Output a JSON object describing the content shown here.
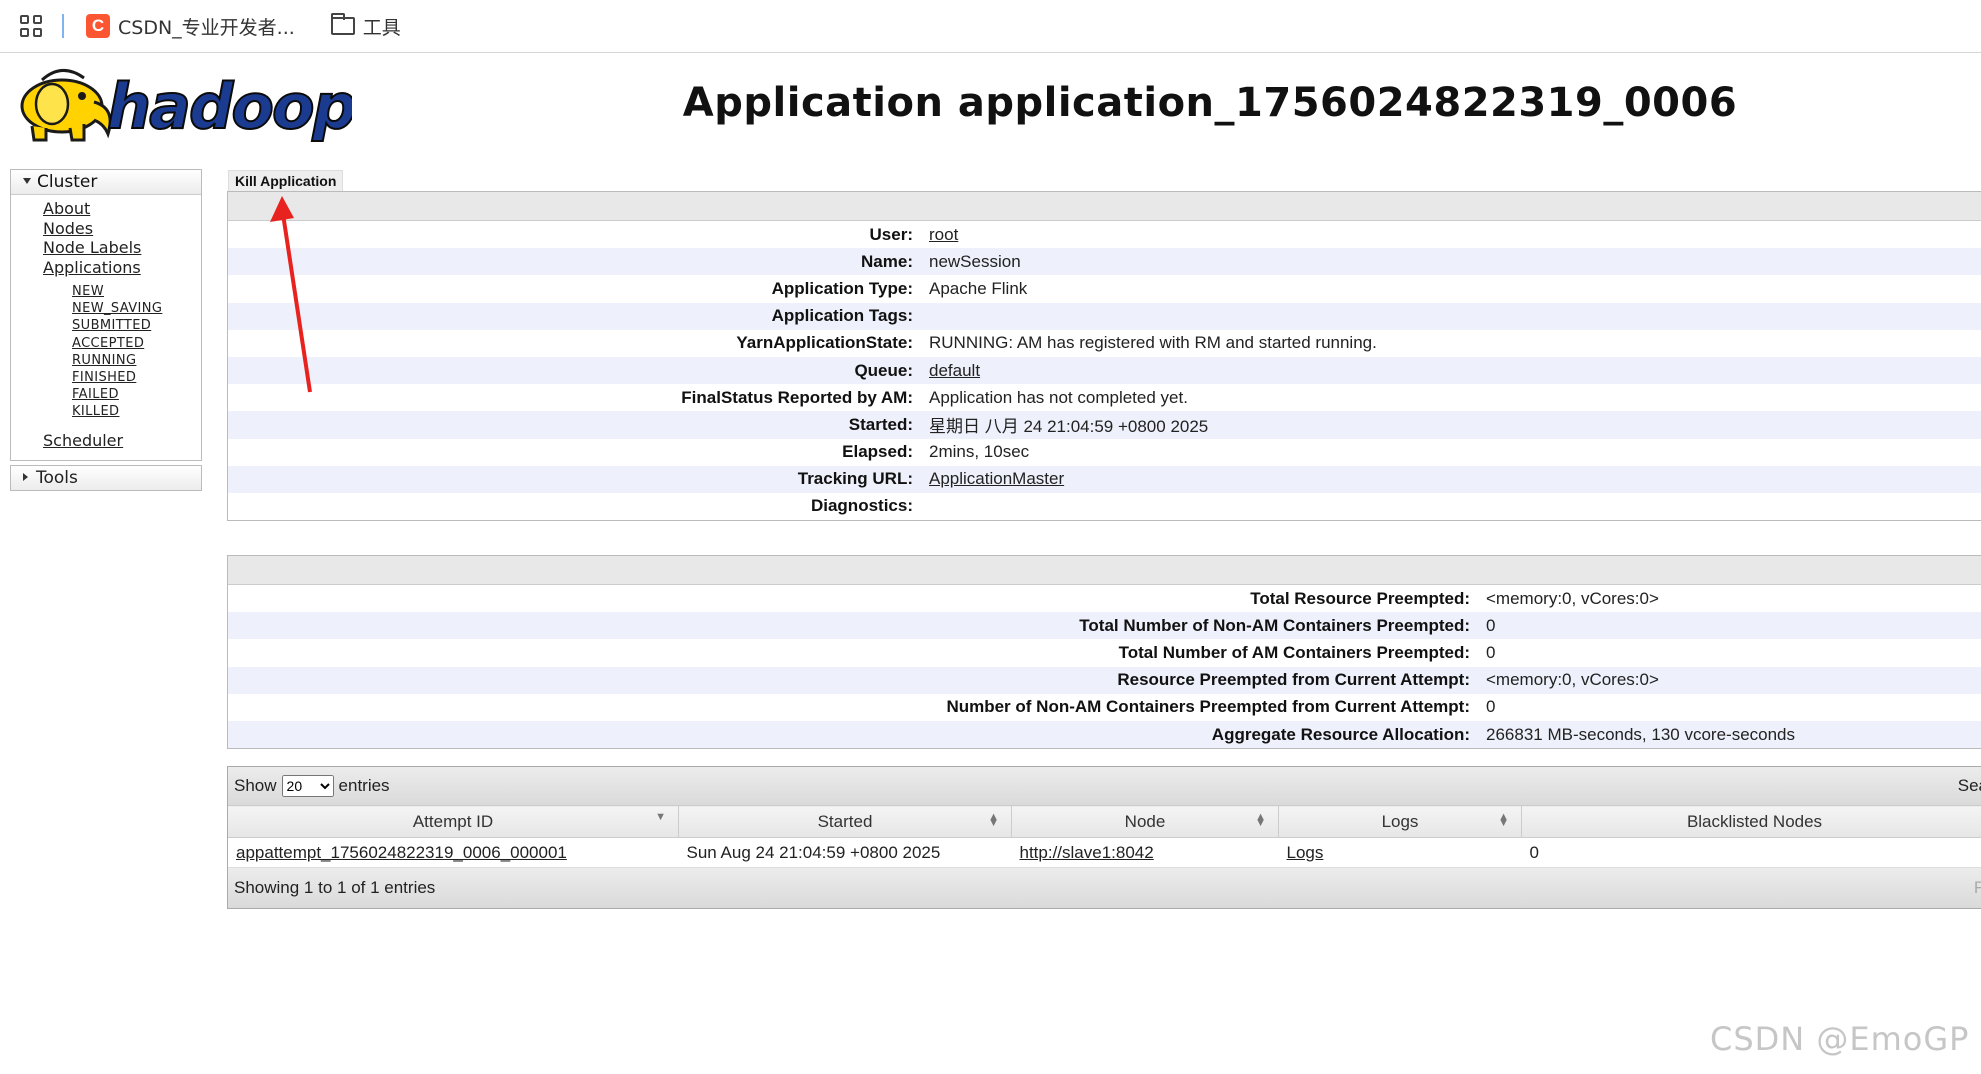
{
  "bookmarks": {
    "items": [
      {
        "label": "CSDN_专业开发者..."
      },
      {
        "label": "工具"
      }
    ]
  },
  "header": {
    "logo_text": "hadoop",
    "title": "Application application_1756024822319_0006"
  },
  "nav": {
    "cluster_label": "Cluster",
    "links": [
      "About",
      "Nodes",
      "Node Labels",
      "Applications"
    ],
    "app_states": [
      "NEW",
      "NEW_SAVING",
      "SUBMITTED",
      "ACCEPTED",
      "RUNNING",
      "FINISHED",
      "FAILED",
      "KILLED"
    ],
    "scheduler": "Scheduler",
    "tools_label": "Tools"
  },
  "kill_button": "Kill Application",
  "app_info": [
    {
      "key": "User:",
      "value": "root"
    },
    {
      "key": "Name:",
      "value": "newSession"
    },
    {
      "key": "Application Type:",
      "value": "Apache Flink"
    },
    {
      "key": "Application Tags:",
      "value": ""
    },
    {
      "key": "YarnApplicationState:",
      "value": "RUNNING: AM has registered with RM and started running."
    },
    {
      "key": "Queue:",
      "value": "default"
    },
    {
      "key": "FinalStatus Reported by AM:",
      "value": "Application has not completed yet."
    },
    {
      "key": "Started:",
      "value": "星期日 八月 24 21:04:59 +0800 2025"
    },
    {
      "key": "Elapsed:",
      "value": "2mins, 10sec"
    },
    {
      "key": "Tracking URL:",
      "value": "ApplicationMaster"
    },
    {
      "key": "Diagnostics:",
      "value": ""
    }
  ],
  "preemption": [
    {
      "key": "Total Resource Preempted:",
      "value": "<memory:0, vCores:0>"
    },
    {
      "key": "Total Number of Non-AM Containers Preempted:",
      "value": "0"
    },
    {
      "key": "Total Number of AM Containers Preempted:",
      "value": "0"
    },
    {
      "key": "Resource Preempted from Current Attempt:",
      "value": "<memory:0, vCores:0>"
    },
    {
      "key": "Number of Non-AM Containers Preempted from Current Attempt:",
      "value": "0"
    },
    {
      "key": "Aggregate Resource Allocation:",
      "value": "266831 MB-seconds, 130 vcore-seconds"
    }
  ],
  "attempts": {
    "show_label": "Show",
    "page_size": "20",
    "entries_label": "entries",
    "search_label": "Sea",
    "columns": [
      "Attempt ID",
      "Started",
      "Node",
      "Logs",
      "Blacklisted Nodes"
    ],
    "rows": [
      [
        "appattempt_1756024822319_0006_000001",
        "Sun Aug 24 21:04:59 +0800 2025",
        "http://slave1:8042",
        "Logs",
        "0"
      ]
    ],
    "footer": "Showing 1 to 1 of 1 entries",
    "footer_right": "Fi"
  },
  "watermark": "CSDN @EmoGP",
  "colors": {
    "arrow": "#e8231f",
    "logo_yellow": "#ffd200",
    "logo_blue": "#1a3b8f"
  }
}
